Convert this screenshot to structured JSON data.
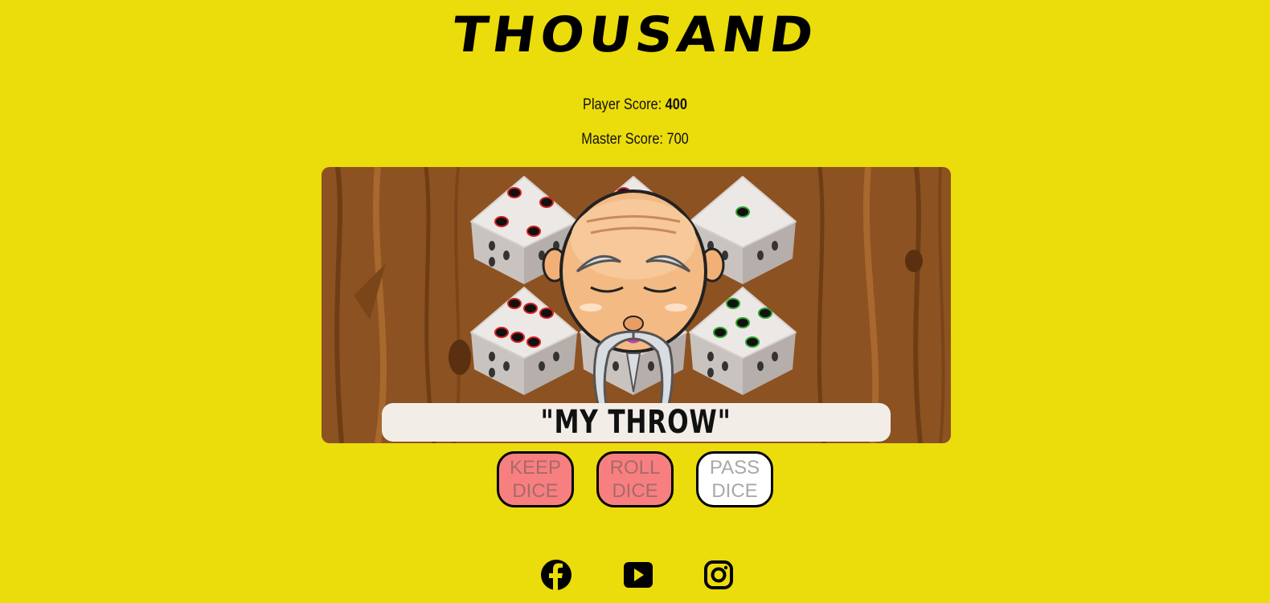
{
  "title": "THOUSAND",
  "scores": {
    "player_label": "Player Score: ",
    "player_value": "400",
    "master_label": "Master Score: ",
    "master_value": "700"
  },
  "board": {
    "speech": "\"MY THROW\"",
    "dice": [
      4,
      6,
      1,
      6,
      6,
      5
    ],
    "dice_pip_colors": [
      "red",
      "red",
      "green",
      "red",
      "red",
      "green"
    ]
  },
  "buttons": {
    "keep_line1": "KEEP",
    "keep_line2": "DICE",
    "roll_line1": "ROLL",
    "roll_line2": "DICE",
    "pass_line1": "PASS",
    "pass_line2": "DICE"
  },
  "social": [
    "facebook-icon",
    "youtube-icon",
    "instagram-icon"
  ],
  "colors": {
    "background": "#ebdc0b",
    "button_red": "#f87f80",
    "button_white": "#ffffff",
    "wood": "#8d5221"
  }
}
